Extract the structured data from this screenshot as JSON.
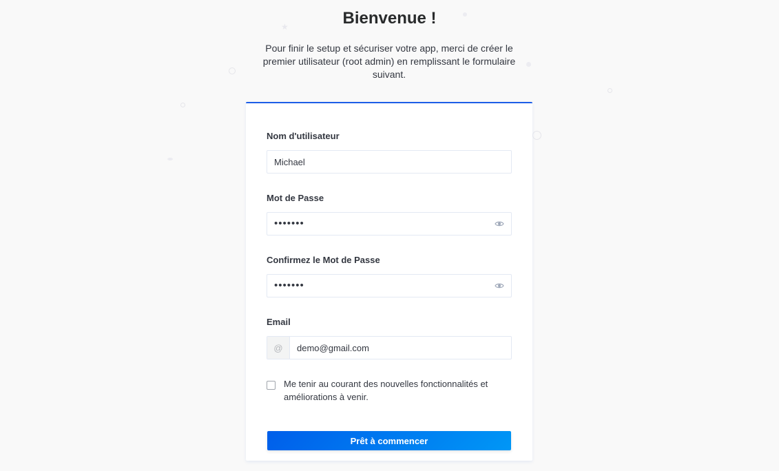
{
  "header": {
    "title": "Bienvenue !",
    "subtitle": "Pour finir le setup et sécuriser votre app, merci de créer le premier utilisateur (root admin) en remplissant le formulaire suivant."
  },
  "form": {
    "username": {
      "label": "Nom d'utilisateur",
      "value": "Michael"
    },
    "password": {
      "label": "Mot de Passe",
      "value": "•••••••"
    },
    "confirm_password": {
      "label": "Confirmez le Mot de Passe",
      "value": "•••••••"
    },
    "email": {
      "label": "Email",
      "prefix": "@",
      "value": "demo@gmail.com"
    },
    "newsletter": {
      "label": "Me tenir au courant des nouvelles fonctionnalités et améliorations à venir.",
      "checked": false
    },
    "submit_label": "Prêt à commencer"
  },
  "icons": {
    "password_toggle": "eye-icon",
    "email_prefix": "at-icon"
  },
  "colors": {
    "accent": "#1c5de7",
    "button_gradient_start": "#005eea",
    "button_gradient_end": "#0097f6",
    "background": "#f9f9f9"
  }
}
